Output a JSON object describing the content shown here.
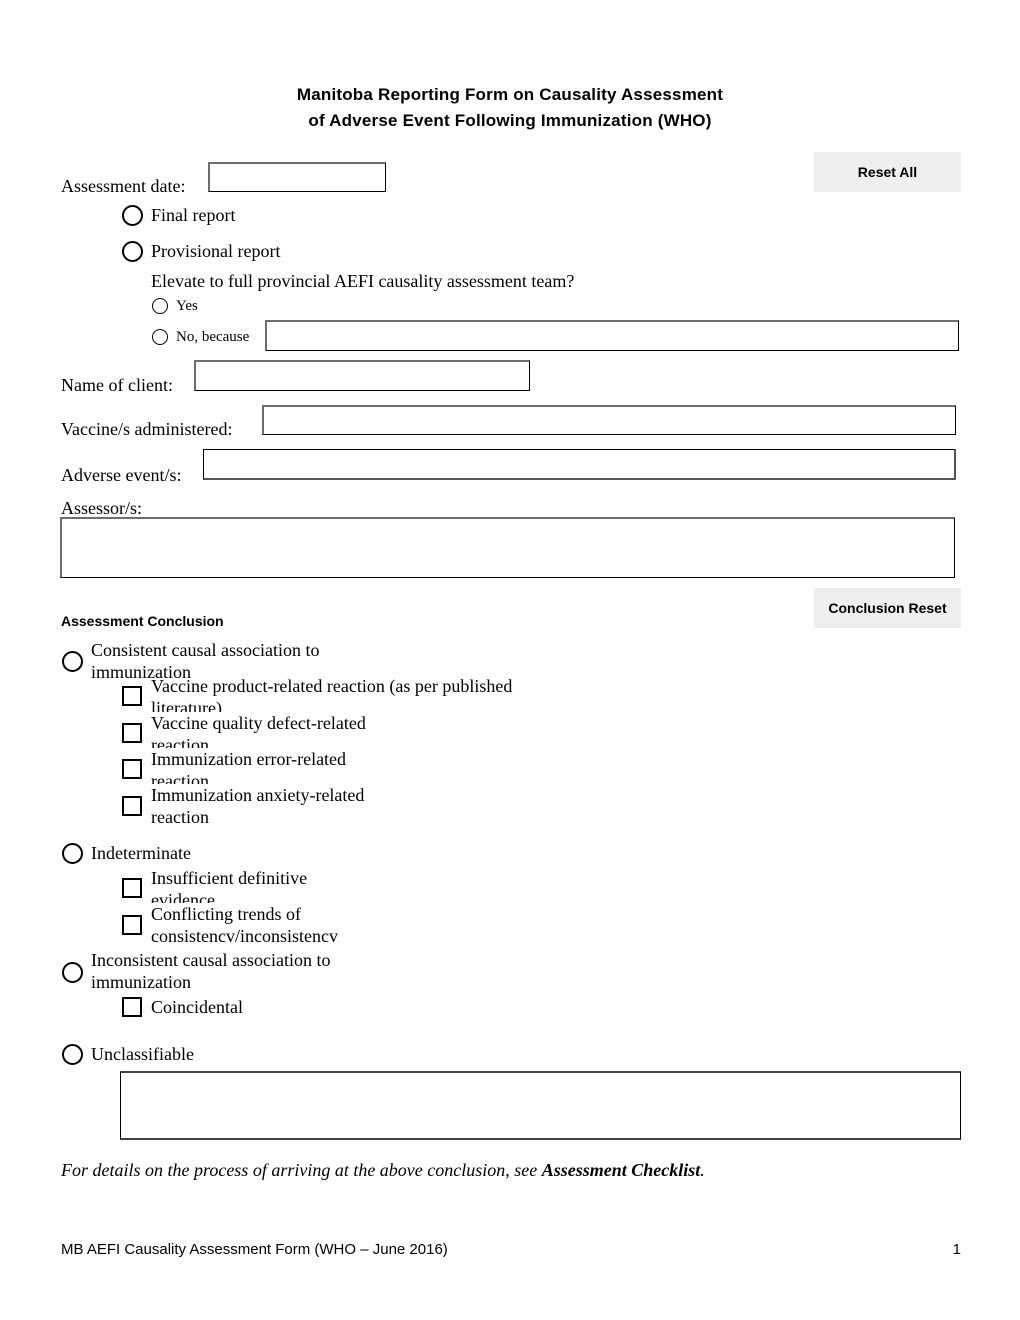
{
  "header": {
    "title_line1": "Manitoba Reporting Form on Causality Assessment",
    "title_line2": "of Adverse Event Following Immunization (WHO)"
  },
  "buttons": {
    "reset_all": "Reset All",
    "conclusion_reset": "Conclusion Reset"
  },
  "form": {
    "assessment_date": {
      "label": "Assessment date:",
      "value": ""
    },
    "report_type": {
      "options": [
        {
          "label": "Final report",
          "selected": false
        },
        {
          "label": "Provisional report",
          "selected": false
        }
      ]
    },
    "elevate": {
      "question": "Elevate to full provincial AEFI causality assessment team?",
      "yes_label": "Yes",
      "no_label": "No, because",
      "no_reason_value": ""
    },
    "client_name": {
      "label": "Name of client:",
      "value": ""
    },
    "vaccines": {
      "label": "Vaccine/s administered:",
      "value": ""
    },
    "adverse_events": {
      "label": "Adverse event/s:",
      "value": ""
    },
    "assessors": {
      "label": "Assessor/s:",
      "value": ""
    }
  },
  "conclusion": {
    "heading": "Assessment Conclusion",
    "groups": [
      {
        "label": "Consistent causal association to immunization",
        "options": [
          "Vaccine product-related reaction (as per published literature)",
          "Vaccine quality defect-related reaction",
          "Immunization error-related reaction",
          "Immunization anxiety-related reaction"
        ]
      },
      {
        "label": "Indeterminate",
        "options": [
          "Insufficient definitive evidence",
          "Conflicting trends of consistencv/inconsistencv"
        ]
      },
      {
        "label": "Inconsistent causal association to immunization",
        "options": [
          "Coincidental"
        ]
      },
      {
        "label": "Unclassifiable",
        "options": []
      }
    ],
    "unclassifiable_notes": ""
  },
  "note": {
    "prefix": "For details on the process of arriving at the above conclusion, see ",
    "link": "Assessment Checklist",
    "suffix": "."
  },
  "footer": {
    "text": "MB AEFI Causality Assessment Form (WHO – June 2016)",
    "page_number": "1"
  }
}
